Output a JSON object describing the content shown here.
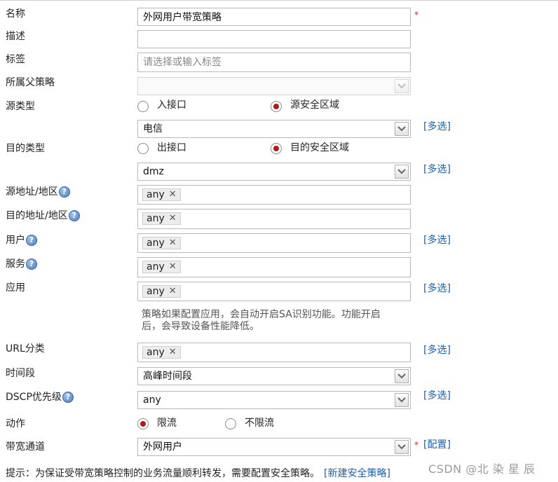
{
  "form": {
    "name": {
      "label": "名称",
      "value": "外网用户带宽策略",
      "required": "*"
    },
    "description": {
      "label": "描述",
      "value": ""
    },
    "tags": {
      "label": "标签",
      "placeholder": "请选择或输入标签"
    },
    "parent_policy": {
      "label": "所属父策略",
      "value": ""
    },
    "source_type": {
      "label": "源类型",
      "options": [
        "入接口",
        "源安全区域"
      ],
      "selected": "源安全区域",
      "value": "电信",
      "multi_link": "[多选]"
    },
    "dest_type": {
      "label": "目的类型",
      "options": [
        "出接口",
        "目的安全区域"
      ],
      "selected": "目的安全区域",
      "value": "dmz",
      "multi_link": "[多选]"
    },
    "source_address": {
      "label": "源地址/地区",
      "tag": "any"
    },
    "dest_address": {
      "label": "目的地址/地区",
      "tag": "any"
    },
    "user": {
      "label": "用户",
      "tag": "any",
      "multi_link": "[多选]"
    },
    "service": {
      "label": "服务",
      "tag": "any"
    },
    "application": {
      "label": "应用",
      "tag": "any",
      "multi_link": "[多选]",
      "note_line1": "策略如果配置应用，会自动开启SA识别功能。功能开启",
      "note_line2": "后，会导致设备性能降低。"
    },
    "url_category": {
      "label": "URL分类",
      "tag": "any",
      "multi_link": "[多选]"
    },
    "time_range": {
      "label": "时间段",
      "value": "高峰时间段"
    },
    "dscp": {
      "label": "DSCP优先级",
      "value": "any",
      "multi_link": "[多选]"
    },
    "action": {
      "label": "动作",
      "options": [
        "限流",
        "不限流"
      ],
      "selected": "限流"
    },
    "bandwidth_channel": {
      "label": "带宽通道",
      "value": "外网用户",
      "required": "*",
      "config_link": "[配置]"
    }
  },
  "tip": {
    "text": "提示：为保证受带宽策略控制的业务流量顺利转发，需要配置安全策略。",
    "link": "[新建安全策略]"
  },
  "watermark": "CSDN @北 染 星 辰",
  "help_glyph": "?",
  "tag_remove_glyph": "✕",
  "colors": {
    "link": "#1a5fb4",
    "radio_checked": "#b11818",
    "required": "#dd2222"
  }
}
